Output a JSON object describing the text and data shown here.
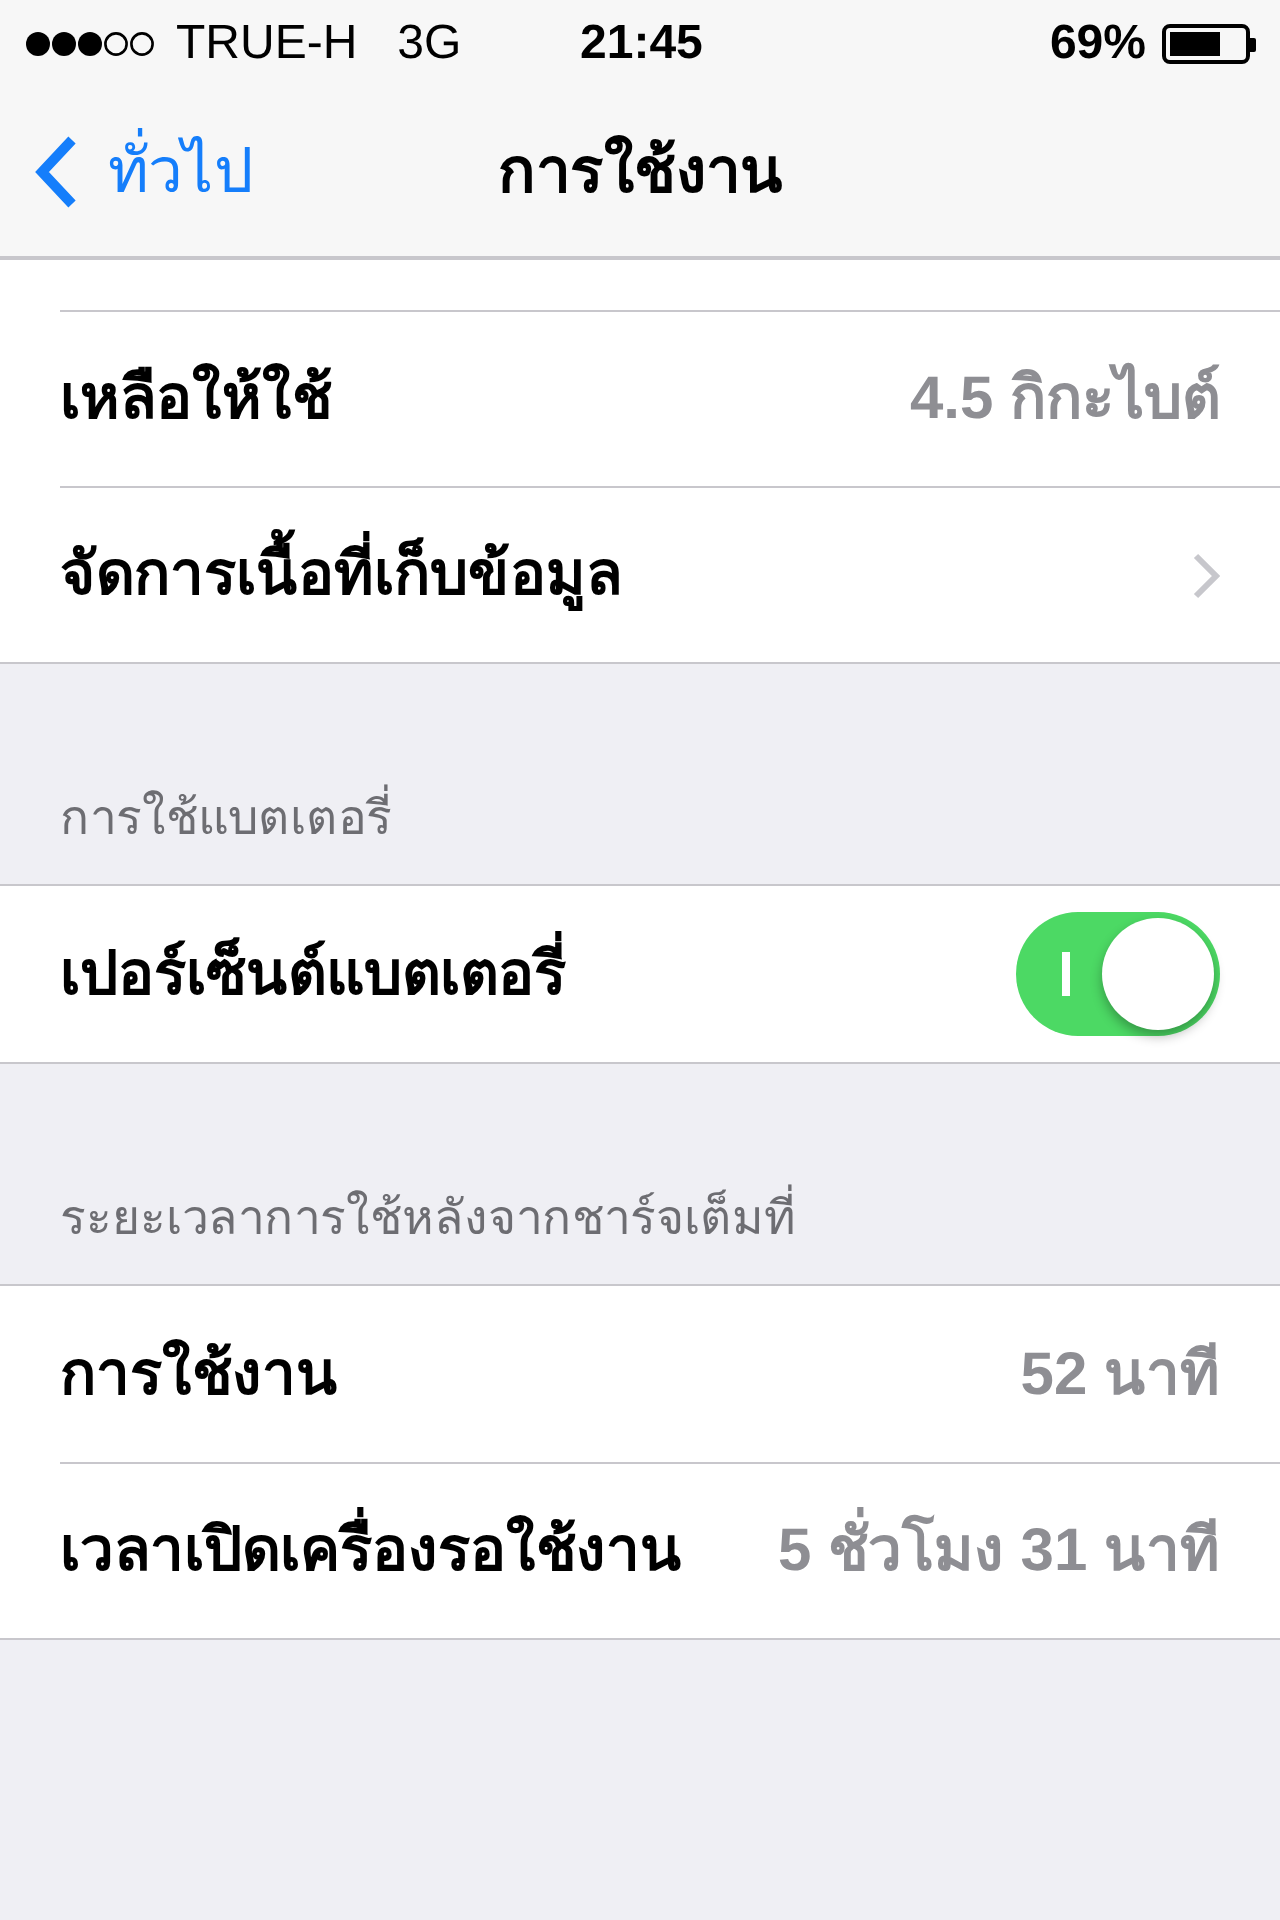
{
  "status_bar": {
    "carrier": "TRUE-H",
    "network": "3G",
    "time": "21:45",
    "battery": "69%"
  },
  "nav": {
    "back": "ทั่วไป",
    "title": "การใช้งาน"
  },
  "groups": [
    {
      "rows": [
        {
          "kind": "value",
          "label": "เหลือให้ใช้",
          "value": "4.5 กิกะไบต์"
        },
        {
          "kind": "link",
          "label": "จัดการเนื้อที่เก็บข้อมูล"
        }
      ]
    },
    {
      "header": "การใช้แบตเตอรี่",
      "rows": [
        {
          "kind": "toggle",
          "label": "เปอร์เซ็นต์แบตเตอรี่",
          "on": true
        }
      ]
    },
    {
      "header": "ระยะเวลาการใช้หลังจากชาร์จเต็มที่",
      "rows": [
        {
          "kind": "value",
          "label": "การใช้งาน",
          "value": "52 นาที"
        },
        {
          "kind": "value",
          "label": "เวลาเปิดเครื่องรอใช้งาน",
          "value": "5 ชั่วโมง 31 นาที"
        }
      ]
    }
  ]
}
